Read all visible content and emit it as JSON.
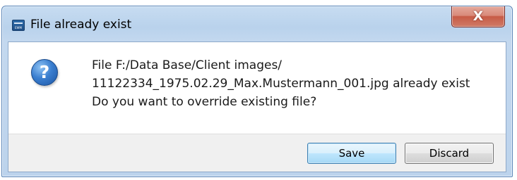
{
  "window": {
    "title": "File already exist",
    "app_icon_text": "EWM",
    "close_glyph": "X"
  },
  "message": {
    "icon": "question-icon",
    "icon_glyph": "?",
    "lines": [
      "File F:/Data Base/Client images/",
      "11122334_1975.02.29_Max.Mustermann_001.jpg already exist",
      "Do you want to override existing file?"
    ]
  },
  "buttons": {
    "save_label": "Save",
    "discard_label": "Discard"
  },
  "colors": {
    "titlebar": "#bcd3ec",
    "close_button": "#c75b46",
    "question_icon": "#3b7fd0",
    "default_button_border": "#3c7fb1",
    "footer": "#f0f0f0"
  }
}
